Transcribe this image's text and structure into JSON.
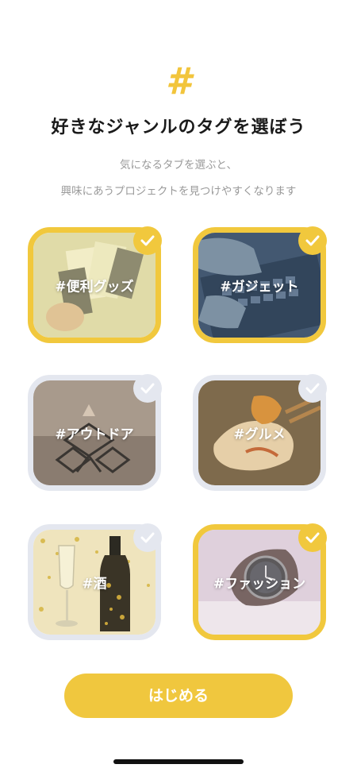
{
  "header": {
    "icon": "hashtag-icon",
    "title": "好きなジャンルのタグを選ぼう",
    "subtitle_line1": "気になるタブを選ぶと、",
    "subtitle_line2": "興味にあうプロジェクトを見つけやすくなります"
  },
  "tags": [
    {
      "label": "#便利グッズ",
      "selected": true
    },
    {
      "label": "#ガジェット",
      "selected": true
    },
    {
      "label": "#アウトドア",
      "selected": false
    },
    {
      "label": "#グルメ",
      "selected": false
    },
    {
      "label": "#酒",
      "selected": false
    },
    {
      "label": "#ファッション",
      "selected": true
    }
  ],
  "start_button": {
    "label": "はじめる"
  },
  "colors": {
    "accent": "#f1c83d",
    "unselected_border": "#e4e7ef"
  }
}
